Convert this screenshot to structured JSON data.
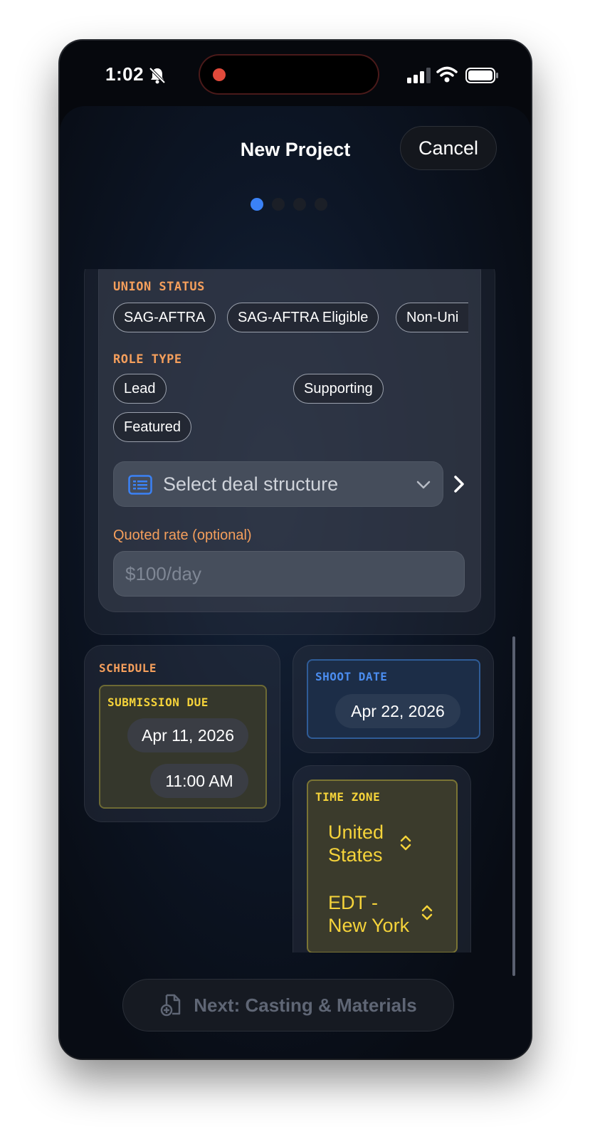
{
  "status_bar": {
    "time": "1:02"
  },
  "header": {
    "title": "New Project",
    "cancel_label": "Cancel",
    "steps": 4,
    "current_step": 1
  },
  "form": {
    "union_status": {
      "label": "UNION STATUS",
      "options": [
        "SAG-AFTRA",
        "SAG-AFTRA Eligible",
        "Non-Uni"
      ]
    },
    "role_type": {
      "label": "ROLE TYPE",
      "options": [
        "Lead",
        "Supporting",
        "Featured"
      ]
    },
    "deal_structure": {
      "placeholder": "Select deal structure"
    },
    "quoted_rate": {
      "label": "Quoted rate (optional)",
      "placeholder": "$100/day"
    }
  },
  "schedule": {
    "label": "SCHEDULE",
    "submission_due": {
      "label": "SUBMISSION DUE",
      "date": "Apr 11, 2026",
      "time": "11:00 AM"
    },
    "shoot_date": {
      "label": "SHOOT DATE",
      "date": "Apr 22, 2026"
    },
    "time_zone": {
      "label": "TIME ZONE",
      "country_line1": "United",
      "country_line2": "States",
      "zone_line1": "EDT -",
      "zone_line2": "New York"
    }
  },
  "footer": {
    "next_label": "Next: Casting & Materials"
  },
  "colors": {
    "accent_orange": "#f59f5c",
    "accent_blue": "#3b82f6",
    "accent_yellow": "#f5d33a"
  }
}
